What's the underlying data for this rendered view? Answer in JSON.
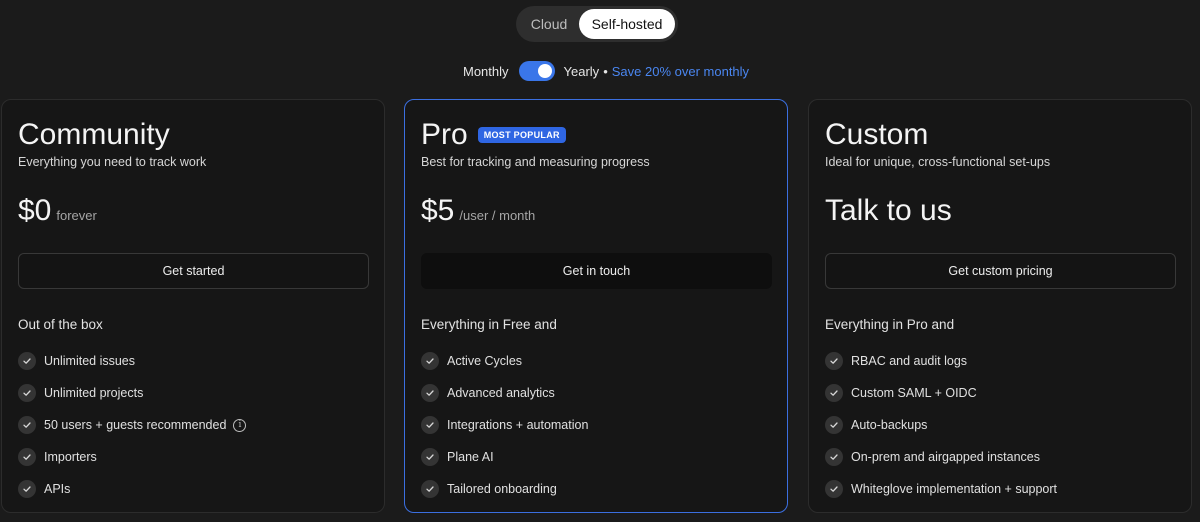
{
  "deployment_toggle": {
    "options": [
      "Cloud",
      "Self-hosted"
    ],
    "selected": "Self-hosted"
  },
  "billing": {
    "monthly_label": "Monthly",
    "yearly_label": "Yearly",
    "separator": "•",
    "savings_note": "Save 20% over monthly",
    "yearly_enabled": true
  },
  "colors": {
    "accent": "#3b6fe0",
    "badge": "#2f66e3",
    "link": "#4a86f0",
    "background": "#1b1b1b"
  },
  "plans": [
    {
      "name": "Community",
      "badge": "",
      "description": "Everything you need to track work",
      "price": "$0",
      "price_unit": "forever",
      "cta": "Get started",
      "features_heading": "Out of the box",
      "features": [
        "Unlimited issues",
        "Unlimited projects",
        "50 users + guests recommended",
        "Importers",
        "APIs"
      ],
      "info_icon_on": "50 users + guests recommended"
    },
    {
      "name": "Pro",
      "badge": "MOST POPULAR",
      "description": "Best for tracking and measuring progress",
      "price": "$5",
      "price_unit": "/user / month",
      "cta": "Get in touch",
      "features_heading": "Everything in Free and",
      "features": [
        "Active Cycles",
        "Advanced analytics",
        "Integrations + automation",
        "Plane AI",
        "Tailored onboarding"
      ]
    },
    {
      "name": "Custom",
      "badge": "",
      "description": "Ideal for unique, cross-functional set-ups",
      "price_text": "Talk to us",
      "cta": "Get custom pricing",
      "features_heading": "Everything in Pro and",
      "features": [
        "RBAC and audit logs",
        "Custom SAML + OIDC",
        "Auto-backups",
        "On-prem and airgapped instances",
        "Whiteglove implementation + support"
      ]
    }
  ]
}
